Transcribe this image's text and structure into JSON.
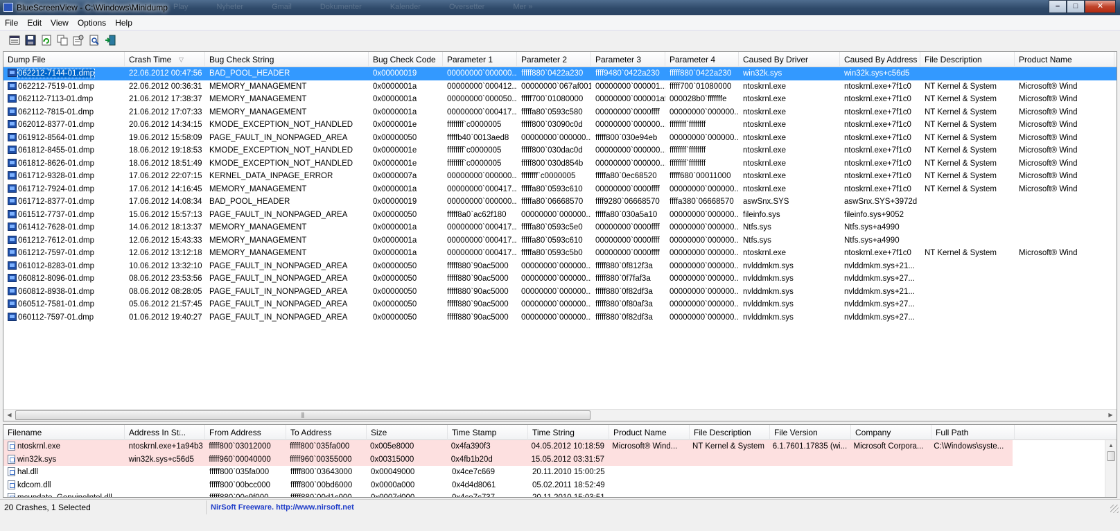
{
  "window": {
    "title": "BlueScreenView  -  C:\\Windows\\Minidump",
    "ghost_tabs": [
      "Play",
      "Nyheter",
      "Gmail",
      "Dokumenter",
      "Kalender",
      "Oversetter",
      "Mer »"
    ],
    "buttons": {
      "minimize": "–",
      "maximize": "□",
      "close": "✕"
    }
  },
  "menu": [
    "File",
    "Edit",
    "View",
    "Options",
    "Help"
  ],
  "toolbar": {
    "icons": [
      "html-report-icon",
      "save-icon",
      "refresh-icon",
      "copy-icon",
      "properties-icon",
      "find-icon",
      "exit-icon"
    ]
  },
  "upper": {
    "columns": [
      "Dump File",
      "Crash Time",
      "Bug Check String",
      "Bug Check Code",
      "Parameter 1",
      "Parameter 2",
      "Parameter 3",
      "Parameter 4",
      "Caused By Driver",
      "Caused By Address",
      "File Description",
      "Product Name"
    ],
    "sort_indicator": "▽",
    "rows": [
      [
        "062212-7144-01.dmp",
        "22.06.2012 00:47:56",
        "BAD_POOL_HEADER",
        "0x00000019",
        "00000000`000000...",
        "fffff880`0422a230",
        "ffff9480`0422a230",
        "fffff880`0422a230",
        "win32k.sys",
        "win32k.sys+c56d5",
        "",
        ""
      ],
      [
        "062212-7519-01.dmp",
        "22.06.2012 00:36:31",
        "MEMORY_MANAGEMENT",
        "0x0000001a",
        "00000000`000412...",
        "00000000`067af001",
        "00000000`000001...",
        "fffff700`01080000",
        "ntoskrnl.exe",
        "ntoskrnl.exe+7f1c0",
        "NT Kernel & System",
        "Microsoft® Wind"
      ],
      [
        "062112-7113-01.dmp",
        "21.06.2012 17:38:37",
        "MEMORY_MANAGEMENT",
        "0x0000001a",
        "00000000`000050...",
        "fffff700`01080000",
        "00000000`000001af",
        "000028b0`fffffffe",
        "ntoskrnl.exe",
        "ntoskrnl.exe+7f1c0",
        "NT Kernel & System",
        "Microsoft® Wind"
      ],
      [
        "062112-7815-01.dmp",
        "21.06.2012 17:07:33",
        "MEMORY_MANAGEMENT",
        "0x0000001a",
        "00000000`000417...",
        "fffffa80`0593c580",
        "00000000`0000ffff",
        "00000000`000000...",
        "ntoskrnl.exe",
        "ntoskrnl.exe+7f1c0",
        "NT Kernel & System",
        "Microsoft® Wind"
      ],
      [
        "062012-8377-01.dmp",
        "20.06.2012 14:34:15",
        "KMODE_EXCEPTION_NOT_HANDLED",
        "0x0000001e",
        "ffffffff`c0000005",
        "fffff800`03090c0d",
        "00000000`000000...",
        "ffffffff`ffffffff",
        "ntoskrnl.exe",
        "ntoskrnl.exe+7f1c0",
        "NT Kernel & System",
        "Microsoft® Wind"
      ],
      [
        "061912-8564-01.dmp",
        "19.06.2012 15:58:09",
        "PAGE_FAULT_IN_NONPAGED_AREA",
        "0x00000050",
        "fffffb40`0013aed8",
        "00000000`000000...",
        "fffff800`030e94eb",
        "00000000`000000...",
        "ntoskrnl.exe",
        "ntoskrnl.exe+7f1c0",
        "NT Kernel & System",
        "Microsoft® Wind"
      ],
      [
        "061812-8455-01.dmp",
        "18.06.2012 19:18:53",
        "KMODE_EXCEPTION_NOT_HANDLED",
        "0x0000001e",
        "ffffffff`c0000005",
        "fffff800`030dac0d",
        "00000000`000000...",
        "ffffffff`ffffffff",
        "ntoskrnl.exe",
        "ntoskrnl.exe+7f1c0",
        "NT Kernel & System",
        "Microsoft® Wind"
      ],
      [
        "061812-8626-01.dmp",
        "18.06.2012 18:51:49",
        "KMODE_EXCEPTION_NOT_HANDLED",
        "0x0000001e",
        "ffffffff`c0000005",
        "fffff800`030d854b",
        "00000000`000000...",
        "ffffffff`ffffffff",
        "ntoskrnl.exe",
        "ntoskrnl.exe+7f1c0",
        "NT Kernel & System",
        "Microsoft® Wind"
      ],
      [
        "061712-9328-01.dmp",
        "17.06.2012 22:07:15",
        "KERNEL_DATA_INPAGE_ERROR",
        "0x0000007a",
        "00000000`000000...",
        "ffffffff`c0000005",
        "fffffa80`0ec68520",
        "fffff680`00011000",
        "ntoskrnl.exe",
        "ntoskrnl.exe+7f1c0",
        "NT Kernel & System",
        "Microsoft® Wind"
      ],
      [
        "061712-7924-01.dmp",
        "17.06.2012 14:16:45",
        "MEMORY_MANAGEMENT",
        "0x0000001a",
        "00000000`000417...",
        "fffffa80`0593c610",
        "00000000`0000ffff",
        "00000000`000000...",
        "ntoskrnl.exe",
        "ntoskrnl.exe+7f1c0",
        "NT Kernel & System",
        "Microsoft® Wind"
      ],
      [
        "061712-8377-01.dmp",
        "17.06.2012 14:08:34",
        "BAD_POOL_HEADER",
        "0x00000019",
        "00000000`000000...",
        "fffffa80`06668570",
        "ffff9280`06668570",
        "ffffa380`06668570",
        "aswSnx.SYS",
        "aswSnx.SYS+3972d",
        "",
        ""
      ],
      [
        "061512-7737-01.dmp",
        "15.06.2012 15:57:13",
        "PAGE_FAULT_IN_NONPAGED_AREA",
        "0x00000050",
        "fffff8a0`ac62f180",
        "00000000`000000...",
        "fffffa80`030a5a10",
        "00000000`000000...",
        "fileinfo.sys",
        "fileinfo.sys+9052",
        "",
        ""
      ],
      [
        "061412-7628-01.dmp",
        "14.06.2012 18:13:37",
        "MEMORY_MANAGEMENT",
        "0x0000001a",
        "00000000`000417...",
        "fffffa80`0593c5e0",
        "00000000`0000ffff",
        "00000000`000000...",
        "Ntfs.sys",
        "Ntfs.sys+a4990",
        "",
        ""
      ],
      [
        "061212-7612-01.dmp",
        "12.06.2012 15:43:33",
        "MEMORY_MANAGEMENT",
        "0x0000001a",
        "00000000`000417...",
        "fffffa80`0593c610",
        "00000000`0000ffff",
        "00000000`000000...",
        "Ntfs.sys",
        "Ntfs.sys+a4990",
        "",
        ""
      ],
      [
        "061212-7597-01.dmp",
        "12.06.2012 13:12:18",
        "MEMORY_MANAGEMENT",
        "0x0000001a",
        "00000000`000417...",
        "fffffa80`0593c5b0",
        "00000000`0000ffff",
        "00000000`000000...",
        "ntoskrnl.exe",
        "ntoskrnl.exe+7f1c0",
        "NT Kernel & System",
        "Microsoft® Wind"
      ],
      [
        "061012-8283-01.dmp",
        "10.06.2012 13:32:10",
        "PAGE_FAULT_IN_NONPAGED_AREA",
        "0x00000050",
        "fffff880`90ac5000",
        "00000000`000000...",
        "fffff880`0f812f3a",
        "00000000`000000...",
        "nvlddmkm.sys",
        "nvlddmkm.sys+21...",
        "",
        ""
      ],
      [
        "060812-8096-01.dmp",
        "08.06.2012 23:53:56",
        "PAGE_FAULT_IN_NONPAGED_AREA",
        "0x00000050",
        "fffff880`90ac5000",
        "00000000`000000...",
        "fffff880`0f7faf3a",
        "00000000`000000...",
        "nvlddmkm.sys",
        "nvlddmkm.sys+27...",
        "",
        ""
      ],
      [
        "060812-8938-01.dmp",
        "08.06.2012 08:28:05",
        "PAGE_FAULT_IN_NONPAGED_AREA",
        "0x00000050",
        "fffff880`90ac5000",
        "00000000`000000...",
        "fffff880`0f82df3a",
        "00000000`000000...",
        "nvlddmkm.sys",
        "nvlddmkm.sys+21...",
        "",
        ""
      ],
      [
        "060512-7581-01.dmp",
        "05.06.2012 21:57:45",
        "PAGE_FAULT_IN_NONPAGED_AREA",
        "0x00000050",
        "fffff880`90ac5000",
        "00000000`000000...",
        "fffff880`0f80af3a",
        "00000000`000000...",
        "nvlddmkm.sys",
        "nvlddmkm.sys+27...",
        "",
        ""
      ],
      [
        "060112-7597-01.dmp",
        "01.06.2012 19:40:27",
        "PAGE_FAULT_IN_NONPAGED_AREA",
        "0x00000050",
        "fffff880`90ac5000",
        "00000000`000000...",
        "fffff880`0f82df3a",
        "00000000`000000...",
        "nvlddmkm.sys",
        "nvlddmkm.sys+27...",
        "",
        ""
      ]
    ],
    "selected_row": 0,
    "scroll_grip": "⫼"
  },
  "lower": {
    "columns": [
      "Filename",
      "Address In St...",
      "From Address",
      "To Address",
      "Size",
      "Time Stamp",
      "Time String",
      "Product Name",
      "File Description",
      "File Version",
      "Company",
      "Full Path"
    ],
    "sort_indicator": "/",
    "rows": [
      {
        "highlight": true,
        "cells": [
          "ntoskrnl.exe",
          "ntoskrnl.exe+1a94b3",
          "fffff800`03012000",
          "fffff800`035fa000",
          "0x005e8000",
          "0x4fa390f3",
          "04.05.2012 10:18:59",
          "Microsoft® Wind...",
          "NT Kernel & System",
          "6.1.7601.17835 (wi...",
          "Microsoft Corpora...",
          "C:\\Windows\\syste..."
        ]
      },
      {
        "highlight": true,
        "cells": [
          "win32k.sys",
          "win32k.sys+c56d5",
          "fffff960`00040000",
          "fffff960`00355000",
          "0x00315000",
          "0x4fb1b20d",
          "15.05.2012 03:31:57",
          "",
          "",
          "",
          "",
          ""
        ]
      },
      {
        "highlight": false,
        "cells": [
          "hal.dll",
          "",
          "fffff800`035fa000",
          "fffff800`03643000",
          "0x00049000",
          "0x4ce7c669",
          "20.11.2010 15:00:25",
          "",
          "",
          "",
          "",
          ""
        ]
      },
      {
        "highlight": false,
        "cells": [
          "kdcom.dll",
          "",
          "fffff800`00bcc000",
          "fffff800`00bd6000",
          "0x0000a000",
          "0x4d4d8061",
          "05.02.2011 18:52:49",
          "",
          "",
          "",
          "",
          ""
        ]
      },
      {
        "highlight": false,
        "cells": [
          "mcupdate_GenuineIntel.dll",
          "",
          "fffff880`00c9f000",
          "fffff880`00d1c000",
          "0x0007d000",
          "0x4ce7c737",
          "20.11.2010 15:03:51",
          "",
          "",
          "",
          "",
          ""
        ]
      }
    ]
  },
  "status": {
    "crashes": "20 Crashes, 1 Selected",
    "freeware": "NirSoft Freeware.  http://www.nirsoft.net"
  }
}
